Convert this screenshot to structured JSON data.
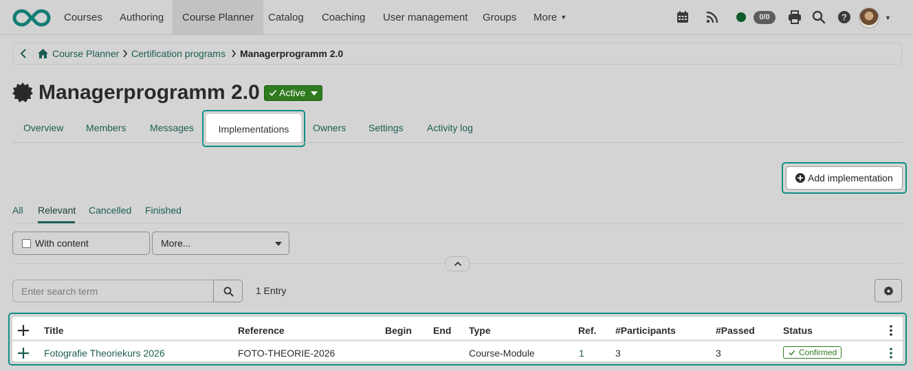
{
  "nav": {
    "items": [
      {
        "label": "Courses"
      },
      {
        "label": "Authoring"
      },
      {
        "label": "Course Planner"
      },
      {
        "label": "Catalog"
      },
      {
        "label": "Coaching"
      },
      {
        "label": "User management"
      },
      {
        "label": "Groups"
      },
      {
        "label": "More"
      }
    ],
    "active": "Course Planner",
    "status_count": "0/0",
    "icons": [
      "calendar-icon",
      "rss-icon",
      "status-dot",
      "print-icon",
      "search-icon",
      "help-icon",
      "avatar"
    ]
  },
  "breadcrumb": {
    "items": [
      "Course Planner",
      "Certification programs",
      "Managerprogramm 2.0"
    ]
  },
  "page": {
    "title": "Managerprogramm 2.0",
    "status_label": "Active",
    "status_color": "#2f7b1f"
  },
  "tabs": [
    {
      "label": "Overview"
    },
    {
      "label": "Members"
    },
    {
      "label": "Messages"
    },
    {
      "label": "Implementations"
    },
    {
      "label": "Owners"
    },
    {
      "label": "Settings"
    },
    {
      "label": "Activity log"
    }
  ],
  "actions": {
    "add_implementation": "Add implementation"
  },
  "filter_tabs": [
    {
      "label": "All"
    },
    {
      "label": "Relevant"
    },
    {
      "label": "Cancelled"
    },
    {
      "label": "Finished"
    }
  ],
  "filters": {
    "with_content_label": "With content",
    "more_label": "More..."
  },
  "search": {
    "placeholder": "Enter search term",
    "entry_count": "1 Entry"
  },
  "table": {
    "columns": [
      "Title",
      "Reference",
      "Begin",
      "End",
      "Type",
      "Ref.",
      "#Participants",
      "#Passed",
      "Status"
    ],
    "rows": [
      {
        "title": "Fotografie Theoriekurs 2026",
        "reference": "FOTO-THEORIE-2026",
        "begin": "",
        "end": "",
        "type": "Course-Module",
        "ref": "1",
        "participants": "3",
        "passed": "3",
        "status": "Confirmed"
      }
    ]
  },
  "colors": {
    "accent": "#1b5d52",
    "highlight": "#0f8e86",
    "success": "#2f7b1f"
  }
}
